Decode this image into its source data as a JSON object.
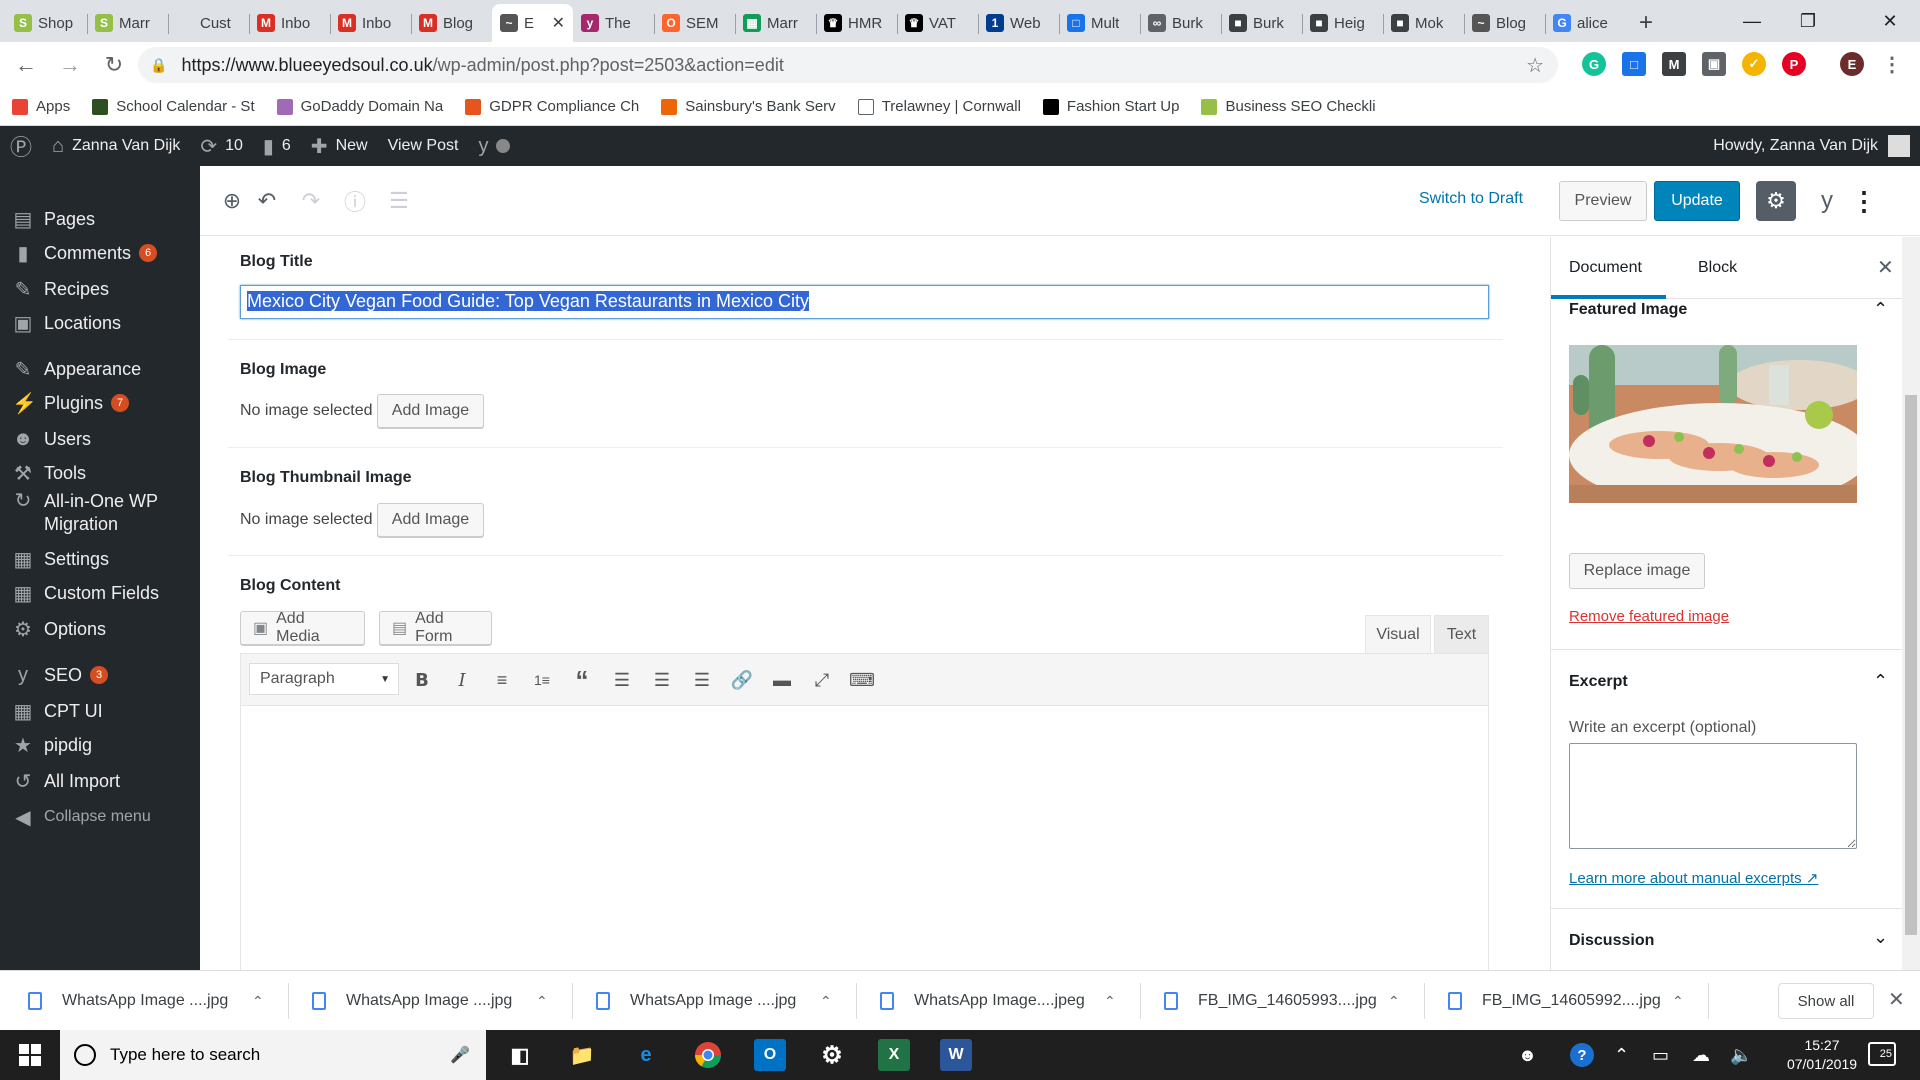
{
  "browser": {
    "tabs": [
      {
        "title": "Shop",
        "icon": "shopify-icon",
        "color": "#95bf47"
      },
      {
        "title": "Marr",
        "icon": "shopify-icon",
        "color": "#95bf47"
      },
      {
        "title": "Cust",
        "icon": "blank-icon",
        "color": "#dee1e6"
      },
      {
        "title": "Inbo",
        "icon": "gmail-icon",
        "color": "#d93025"
      },
      {
        "title": "Inbo",
        "icon": "gmail-icon",
        "color": "#d93025"
      },
      {
        "title": "Blog",
        "icon": "gmail-icon",
        "color": "#d93025"
      },
      {
        "title": "E",
        "icon": "site-icon",
        "color": "#555555",
        "active": true
      },
      {
        "title": "The",
        "icon": "yoast-icon",
        "color": "#a4286a"
      },
      {
        "title": "SEM",
        "icon": "semrush-icon",
        "color": "#ff642d"
      },
      {
        "title": "Marr",
        "icon": "sheets-icon",
        "color": "#0f9d58"
      },
      {
        "title": "HMR",
        "icon": "hmrc-icon",
        "color": "#000000"
      },
      {
        "title": "VAT",
        "icon": "hmrc-icon",
        "color": "#000000"
      },
      {
        "title": "Web",
        "icon": "ionos-icon",
        "color": "#003d8f"
      },
      {
        "title": "Mult",
        "icon": "window-icon",
        "color": "#1a73e8"
      },
      {
        "title": "Burk",
        "icon": "link-icon",
        "color": "#5f6368"
      },
      {
        "title": "Burk",
        "icon": "cube-icon",
        "color": "#3c4043"
      },
      {
        "title": "Heig",
        "icon": "cube-icon",
        "color": "#3c4043"
      },
      {
        "title": "Mok",
        "icon": "cube-icon",
        "color": "#3c4043"
      },
      {
        "title": "Blog",
        "icon": "site-icon",
        "color": "#555555"
      },
      {
        "title": "alice",
        "icon": "google-icon",
        "color": "#4285f4"
      }
    ],
    "url_host": "https://www.blueeyedsoul.co.uk",
    "url_path": "/wp-admin/post.php?post=2503&action=edit",
    "profile_letter": "E",
    "bookmarks": [
      {
        "label": "Apps",
        "color": "#ea4335"
      },
      {
        "label": "School Calendar - St",
        "color": "#2e4f1f"
      },
      {
        "label": "GoDaddy Domain Na",
        "color": "#a06ab4"
      },
      {
        "label": "GDPR Compliance Ch",
        "color": "#e8541e"
      },
      {
        "label": "Sainsbury's Bank Serv",
        "color": "#ec6608"
      },
      {
        "label": "Trelawney | Cornwall",
        "color": "#ffffff"
      },
      {
        "label": "Fashion Start Up",
        "color": "#000000"
      },
      {
        "label": "Business SEO Checkli",
        "color": "#95bf47"
      }
    ]
  },
  "adminbar": {
    "site_name": "Zanna Van Dijk",
    "updates_count": "10",
    "comments_count": "6",
    "new_label": "New",
    "view_post_label": "View Post",
    "howdy": "Howdy, Zanna Van Dijk"
  },
  "menu": {
    "items": [
      {
        "label": "Pages",
        "icon": "pages-icon",
        "badge": ""
      },
      {
        "label": "Comments",
        "icon": "comments-icon",
        "badge": "6"
      },
      {
        "label": "Recipes",
        "icon": "recipes-icon",
        "badge": ""
      },
      {
        "label": "Locations",
        "icon": "locations-icon",
        "badge": ""
      },
      {
        "label": "Appearance",
        "icon": "appearance-icon",
        "badge": ""
      },
      {
        "label": "Plugins",
        "icon": "plugins-icon",
        "badge": "7"
      },
      {
        "label": "Users",
        "icon": "users-icon",
        "badge": ""
      },
      {
        "label": "Tools",
        "icon": "tools-icon",
        "badge": ""
      },
      {
        "label": "All-in-One WP Migration",
        "icon": "migration-icon",
        "badge": ""
      },
      {
        "label": "Settings",
        "icon": "settings-icon",
        "badge": ""
      },
      {
        "label": "Custom Fields",
        "icon": "custom-fields-icon",
        "badge": ""
      },
      {
        "label": "Options",
        "icon": "options-icon",
        "badge": ""
      },
      {
        "label": "SEO",
        "icon": "yoast-icon",
        "badge": "3"
      },
      {
        "label": "CPT UI",
        "icon": "cpt-icon",
        "badge": ""
      },
      {
        "label": "pipdig",
        "icon": "star-icon",
        "badge": ""
      },
      {
        "label": "All Import",
        "icon": "import-icon",
        "badge": ""
      }
    ],
    "collapse_label": "Collapse menu"
  },
  "editor": {
    "switch_to_draft": "Switch to Draft",
    "preview": "Preview",
    "update": "Update"
  },
  "fields": {
    "title_label": "Blog Title",
    "title_value": "Mexico City Vegan Food Guide: Top Vegan Restaurants in Mexico City",
    "image_label": "Blog Image",
    "thumb_label": "Blog Thumbnail Image",
    "no_image": "No image selected",
    "add_image": "Add Image",
    "content_label": "Blog Content",
    "add_media": "Add Media",
    "add_form": "Add Form",
    "visual_tab": "Visual",
    "text_tab": "Text",
    "format_select": "Paragraph"
  },
  "sidebar": {
    "tab_document": "Document",
    "tab_block": "Block",
    "featured_image_title": "Featured Image",
    "replace_image": "Replace image",
    "remove_featured_image": "Remove featured image",
    "excerpt_title": "Excerpt",
    "excerpt_label": "Write an excerpt (optional)",
    "excerpt_value": "",
    "learn_more": "Learn more about manual excerpts",
    "discussion_title": "Discussion",
    "link_color": "#0073aa",
    "danger_color": "#dc3232"
  },
  "downloads": {
    "items": [
      "WhatsApp Image ....jpg",
      "WhatsApp Image ....jpg",
      "WhatsApp Image ....jpg",
      "WhatsApp Image....jpeg",
      "FB_IMG_14605993....jpg",
      "FB_IMG_14605992....jpg"
    ],
    "show_all": "Show all"
  },
  "taskbar": {
    "search_placeholder": "Type here to search",
    "time": "15:27",
    "date": "07/01/2019",
    "notifications": "25"
  }
}
